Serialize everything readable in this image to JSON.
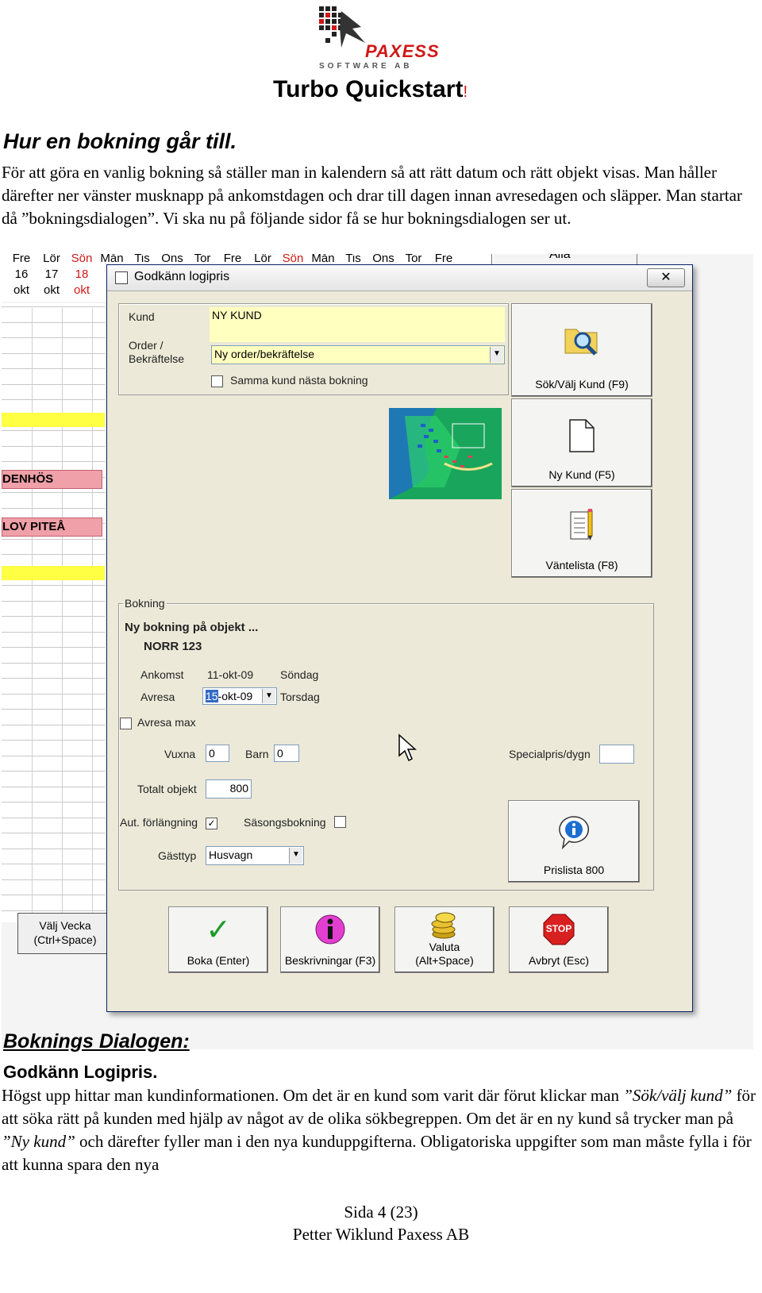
{
  "header": {
    "logo_name": "PAXESS",
    "logo_sub": "SOFTWARE AB",
    "title": "Turbo Quickstart",
    "title_suffix": "!"
  },
  "section1": {
    "heading": "Hur en bokning går till.",
    "paragraph": "För att göra en vanlig bokning så ställer man in kalendern så att rätt datum och rätt objekt visas. Man håller därefter ner vänster musknapp på ankomstdagen och drar till dagen innan avresedagen och släpper. Man startar då ”bokningsdialogen”. Vi ska nu på följande sidor få se hur bokningsdialogen ser ut."
  },
  "calendar": {
    "days": [
      {
        "day": "Fre",
        "date": "16",
        "month": "okt"
      },
      {
        "day": "Lör",
        "date": "17",
        "month": "okt"
      },
      {
        "day": "Sön",
        "date": "18",
        "month": "okt",
        "red": true
      },
      {
        "day": "Mån"
      },
      {
        "day": "Tis"
      },
      {
        "day": "Ons"
      },
      {
        "day": "Tor"
      },
      {
        "day": "Fre"
      },
      {
        "day": "Lör"
      },
      {
        "day": "Sön",
        "red": true
      },
      {
        "day": "Mån"
      },
      {
        "day": "Tis"
      },
      {
        "day": "Ons"
      },
      {
        "day": "Tor"
      },
      {
        "day": "Fre"
      }
    ],
    "right_label": "Alla",
    "booking1": "DENHÖS",
    "booking2": "LOV PITEÅ",
    "valj_vecka": [
      "Välj Vecka",
      "(Ctrl+Space)"
    ]
  },
  "dialog": {
    "title": "Godkänn logipris",
    "close": "✕",
    "kund_label": "Kund",
    "kund_value": "NY KUND",
    "order_label": [
      "Order /",
      "Bekräftelse"
    ],
    "order_value": "Ny order/bekräftelse",
    "samma_kund": "Samma kund nästa bokning",
    "btn_sok": "Sök/Välj Kund (F9)",
    "btn_ny": "Ny Kund (F5)",
    "btn_vantelista": "Väntelista (F8)",
    "bokning_group": "Bokning",
    "ny_bokning": "Ny bokning på objekt ...",
    "objekt": "NORR 123",
    "ankomst_label": "Ankomst",
    "ankomst_date": "11-okt-09",
    "ankomst_day": "Söndag",
    "avresa_label": "Avresa",
    "avresa_sel": "15",
    "avresa_rest": "-okt-09",
    "avresa_day": "Torsdag",
    "avresa_max": "Avresa max",
    "vuxna_label": "Vuxna",
    "vuxna_value": "0",
    "barn_label": "Barn",
    "barn_value": "0",
    "specialpris_label": "Specialpris/dygn",
    "specialpris_value": "",
    "totalt_label": "Totalt objekt",
    "totalt_value": "800",
    "aut_label": "Aut. förlängning",
    "sasong_label": "Säsongsbokning",
    "gasttyp_label": "Gästtyp",
    "gasttyp_value": "Husvagn",
    "prislista": "Prislista 800",
    "btn_boka": "Boka (Enter)",
    "btn_beskr": "Beskrivningar (F3)",
    "btn_valuta": [
      "Valuta",
      "(Alt+Space)"
    ],
    "btn_avbryt": "Avbryt (Esc)",
    "stop_text": "STOP"
  },
  "section2": {
    "heading": "Boknings Dialogen:",
    "subheading": "Godkänn Logipris.",
    "p_start": "Högst upp hittar man kundinformationen. Om det är en kund som varit där förut klickar man ",
    "em1": "”Sök/välj kund”",
    "p_mid": " för att söka rätt på kunden med hjälp av något av de olika sökbegreppen. Om det är en ny kund så trycker man på ",
    "em2": "”Ny kund”",
    "p_end": " och därefter fyller man i den nya kunduppgifterna. Obligatoriska uppgifter som man måste fylla i för att kunna spara den nya"
  },
  "footer": {
    "page": "Sida 4 (23)",
    "author": "Petter Wiklund Paxess AB"
  },
  "colors": {
    "accent_red": "#d01818",
    "yellow_field": "#ffffc0",
    "calendar_yellow": "#ffff44",
    "calendar_pink": "#f0a0a8"
  }
}
